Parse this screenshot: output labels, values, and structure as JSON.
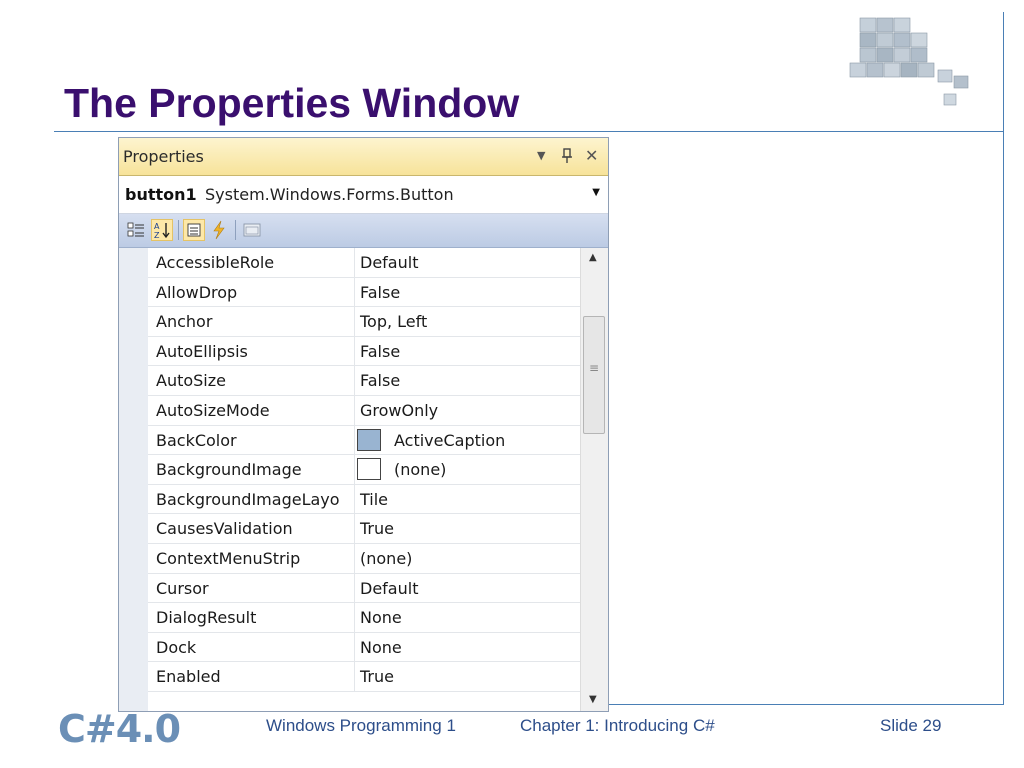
{
  "slide": {
    "title": "The Properties Window",
    "footer": {
      "logo_text": "C#4.0",
      "course": "Windows Programming 1",
      "chapter": "Chapter 1: Introducing C#",
      "slide_number": "Slide 29"
    }
  },
  "properties_window": {
    "title": "Properties",
    "titlebar_icons": [
      "dropdown-icon",
      "pin-icon",
      "close-icon"
    ],
    "object_name": "button1",
    "object_type": "System.Windows.Forms.Button",
    "toolbar_icons": [
      "categorized-icon",
      "alphabetical-icon",
      "properties-icon",
      "events-icon",
      "property-pages-icon"
    ],
    "rows": [
      {
        "name": "AccessibleRole",
        "value": "Default"
      },
      {
        "name": "AllowDrop",
        "value": "False"
      },
      {
        "name": "Anchor",
        "value": "Top, Left"
      },
      {
        "name": "AutoEllipsis",
        "value": "False"
      },
      {
        "name": "AutoSize",
        "value": "False"
      },
      {
        "name": "AutoSizeMode",
        "value": "GrowOnly"
      },
      {
        "name": "BackColor",
        "value": "ActiveCaption",
        "swatch": "#99b4d1"
      },
      {
        "name": "BackgroundImage",
        "value": "(none)",
        "swatch": "#ffffff"
      },
      {
        "name": "BackgroundImageLayo",
        "value": "Tile"
      },
      {
        "name": "CausesValidation",
        "value": "True"
      },
      {
        "name": "ContextMenuStrip",
        "value": "(none)"
      },
      {
        "name": "Cursor",
        "value": "Default"
      },
      {
        "name": "DialogResult",
        "value": "None"
      },
      {
        "name": "Dock",
        "value": "None"
      },
      {
        "name": "Enabled",
        "value": "True"
      }
    ]
  },
  "colors": {
    "title": "#3a0f6e",
    "accent_line": "#4a7fb5",
    "titlebar": "#f7e39a",
    "footer_text": "#2d4e8a"
  }
}
